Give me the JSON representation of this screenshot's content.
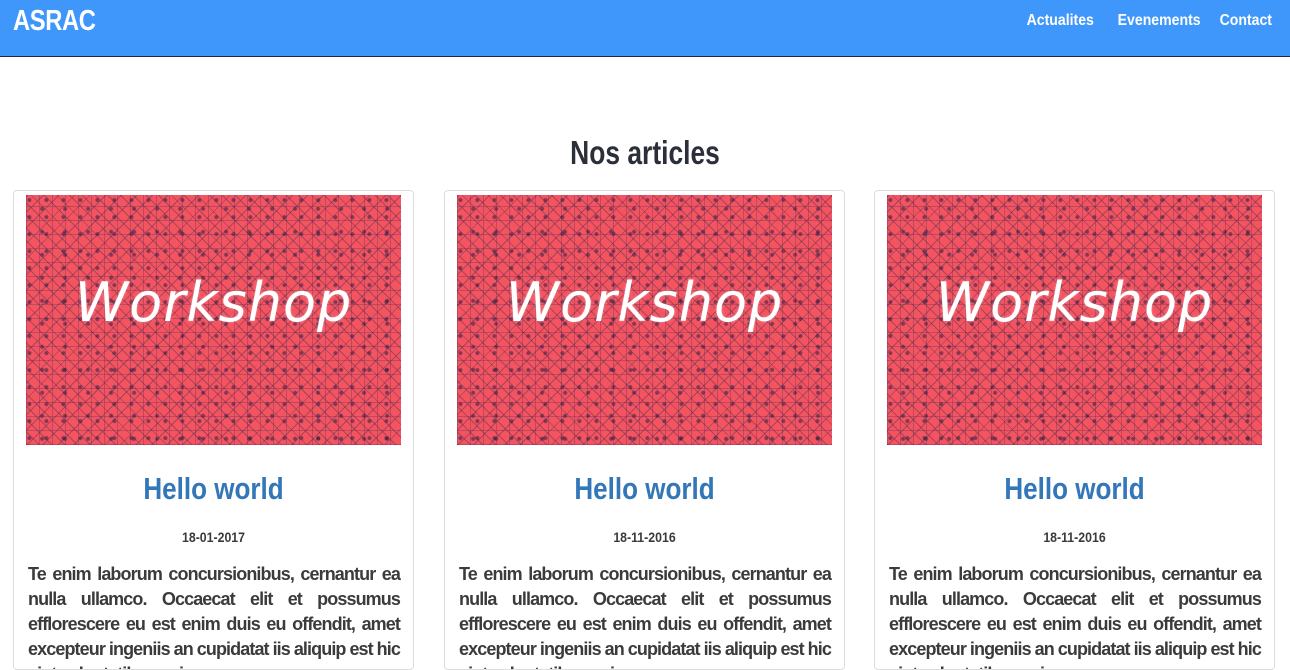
{
  "navbar": {
    "brand": "ASRAC",
    "links": [
      "Actualites",
      "Evenements",
      "Contact"
    ],
    "color": "#4097fb"
  },
  "section": {
    "title": "Nos articles"
  },
  "articles": [
    {
      "image_text": "Workshop",
      "title": "Hello world",
      "date": "18-01-2017",
      "excerpt": "Te enim laborum concursionibus, cernantur ea nulla ullamco. Occaecat elit et possumus efflorescere eu est enim duis eu offendit, amet excepteur ingeniis an cupidatat iis aliquip est hic sint voluptatibus qui"
    },
    {
      "image_text": "Workshop",
      "title": "Hello world",
      "date": "18-11-2016",
      "excerpt": "Te enim laborum concursionibus, cernantur ea nulla ullamco. Occaecat elit et possumus efflorescere eu est enim duis eu offendit, amet excepteur ingeniis an cupidatat iis aliquip est hic sint voluptatibus qui"
    },
    {
      "image_text": "Workshop",
      "title": "Hello world",
      "date": "18-11-2016",
      "excerpt": "Te enim laborum concursionibus, cernantur ea nulla ullamco. Occaecat elit et possumus efflorescere eu est enim duis eu offendit, amet excepteur ingeniis an cupidatat iis aliquip est hic sint voluptatibus qui"
    }
  ],
  "colors": {
    "title_blue": "#3377b8",
    "thumbnail_red": "#f35460"
  }
}
